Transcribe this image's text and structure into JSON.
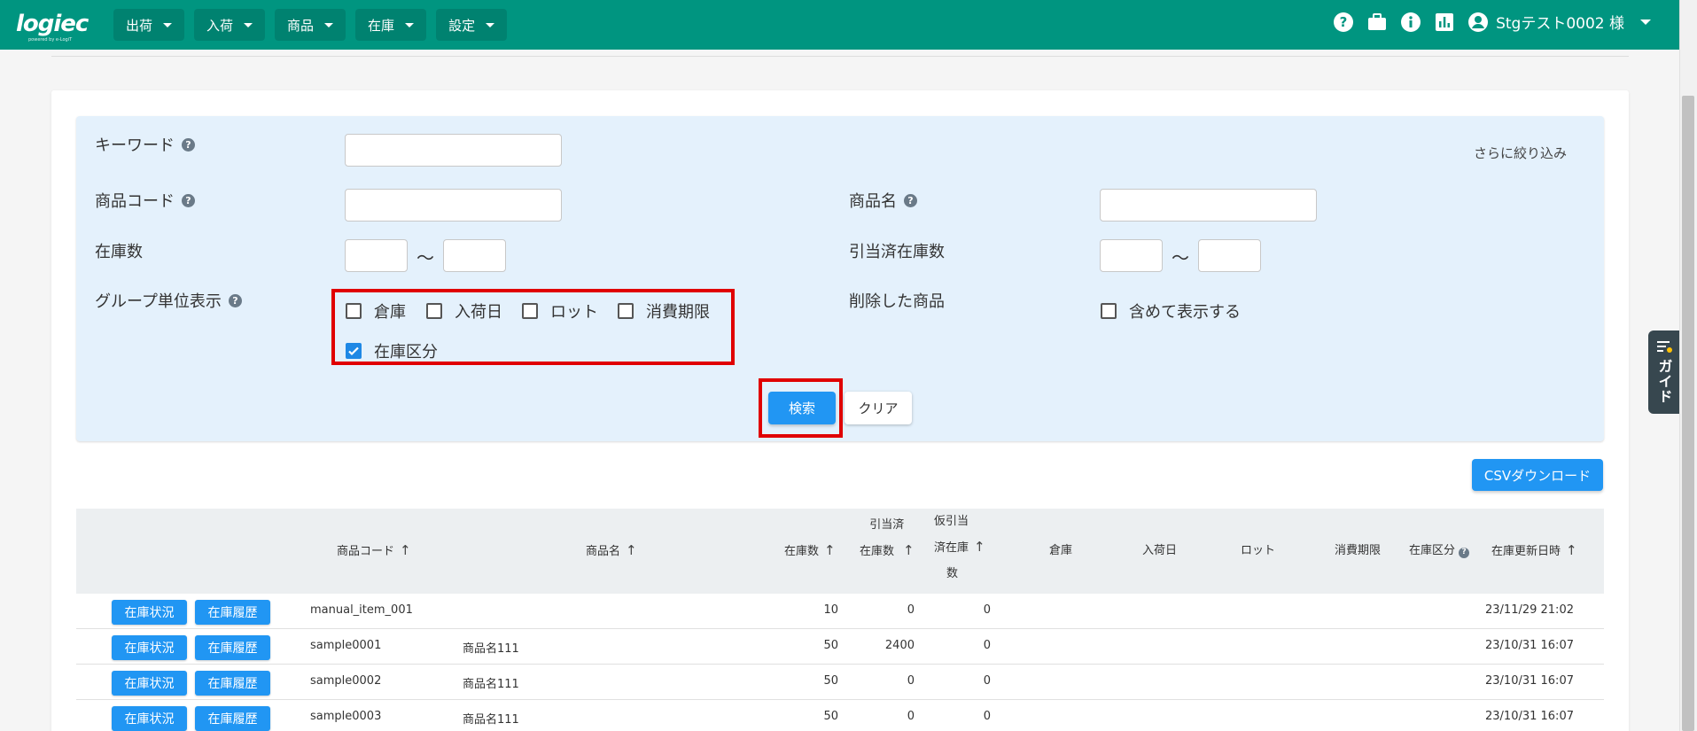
{
  "app": {
    "logo": "logiec",
    "logo_sub": "powered by e-LogiT"
  },
  "nav": {
    "menus": [
      "出荷",
      "入荷",
      "商品",
      "在庫",
      "設定"
    ],
    "user": "Stgテスト0002 様"
  },
  "search": {
    "more_link": "さらに絞り込み",
    "keyword_label": "キーワード",
    "item_code_label": "商品コード",
    "item_name_label": "商品名",
    "stock_qty_label": "在庫数",
    "allocated_qty_label": "引当済在庫数",
    "range_sep": "～",
    "group_label": "グループ単位表示",
    "group_options": [
      {
        "label": "倉庫",
        "checked": false
      },
      {
        "label": "入荷日",
        "checked": false
      },
      {
        "label": "ロット",
        "checked": false
      },
      {
        "label": "消費期限",
        "checked": false
      },
      {
        "label": "在庫区分",
        "checked": true
      }
    ],
    "deleted_label": "削除した商品",
    "deleted_option": "含めて表示する",
    "search_button": "検索",
    "clear_button": "クリア"
  },
  "csv_button": "CSVダウンロード",
  "guide_label": "ガイド",
  "table": {
    "headers": {
      "item_code": "商品コード",
      "item_name": "商品名",
      "stock_qty": "在庫数",
      "allocated_1": "引当済",
      "allocated_2": "在庫数",
      "provisional_1": "仮引当",
      "provisional_2": "済在庫",
      "provisional_3": "数",
      "warehouse": "倉庫",
      "arrival_date": "入荷日",
      "lot": "ロット",
      "expiry": "消費期限",
      "stock_type": "在庫区分",
      "updated_at": "在庫更新日時"
    },
    "row_buttons": {
      "status": "在庫状況",
      "history": "在庫履歴"
    },
    "rows": [
      {
        "code": "manual_item_001",
        "name": "",
        "stock": "10",
        "allocated": "0",
        "provisional": "0",
        "updated": "23/11/29 21:02"
      },
      {
        "code": "sample0001",
        "name": "商品名111",
        "stock": "50",
        "allocated": "2400",
        "provisional": "0",
        "updated": "23/10/31 16:07"
      },
      {
        "code": "sample0002",
        "name": "商品名111",
        "stock": "50",
        "allocated": "0",
        "provisional": "0",
        "updated": "23/10/31 16:07"
      },
      {
        "code": "sample0003",
        "name": "商品名111",
        "stock": "50",
        "allocated": "0",
        "provisional": "0",
        "updated": "23/10/31 16:07"
      }
    ]
  },
  "colors": {
    "header_bg": "#009580",
    "primary": "#2196f3",
    "panel_bg": "#e4f1fc",
    "highlight": "#e00000"
  }
}
